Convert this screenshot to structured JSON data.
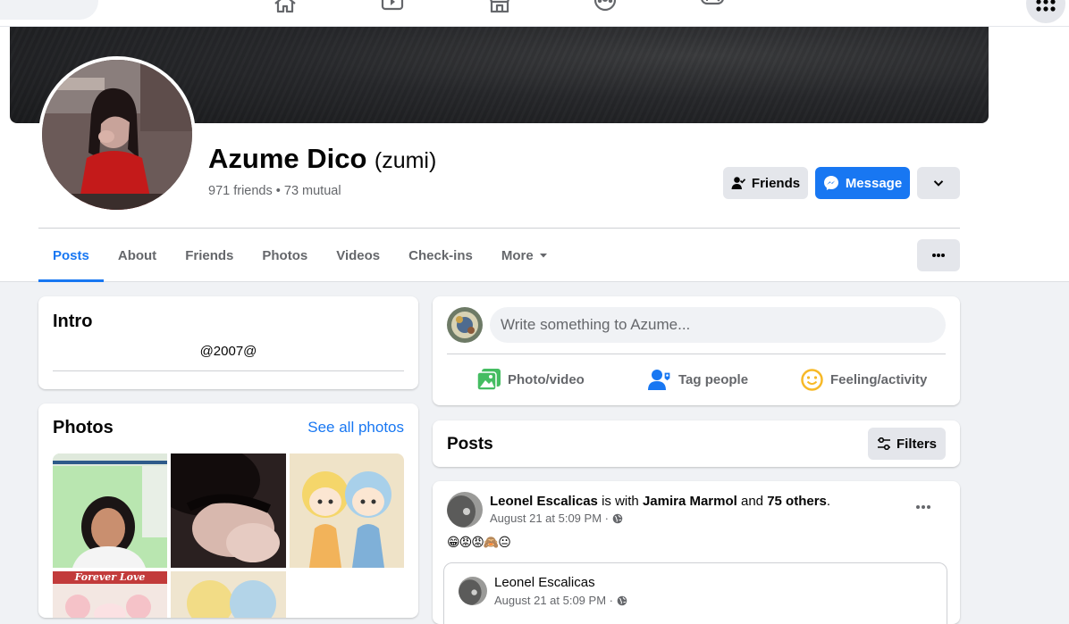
{
  "profile": {
    "name": "Azume Dico",
    "nickname": "(zumi)",
    "friends_summary": "971 friends • 73 mutual"
  },
  "actions": {
    "friends_label": "Friends",
    "message_label": "Message"
  },
  "tabs": [
    {
      "label": "Posts",
      "active": true
    },
    {
      "label": "About"
    },
    {
      "label": "Friends"
    },
    {
      "label": "Photos"
    },
    {
      "label": "Videos"
    },
    {
      "label": "Check-ins"
    },
    {
      "label": "More"
    }
  ],
  "intro": {
    "title": "Intro",
    "bio": "@2007@"
  },
  "photos": {
    "title": "Photos",
    "see_all": "See all photos",
    "tile_caption": "Forever Love"
  },
  "composer": {
    "placeholder": "Write something to Azume...",
    "photo_video": "Photo/video",
    "tag_people": "Tag people",
    "feeling_activity": "Feeling/activity"
  },
  "posts_section": {
    "title": "Posts",
    "filters_label": "Filters"
  },
  "post": {
    "author": "Leonel Escalicas",
    "is_with": "is with",
    "tagged": "Jamira Marmol",
    "and": "and",
    "others": "75 others",
    "period": ".",
    "time": "August 21 at 5:09 PM ·",
    "emojis": "😁😡😡🙈😐",
    "shared_author": "Leonel Escalicas",
    "shared_time": "August 21 at 5:09 PM ·"
  },
  "colors": {
    "accent": "#1877f2",
    "page_bg": "#f0f2f5",
    "secondary_text": "#65676b",
    "button_gray": "#e4e6eb"
  }
}
